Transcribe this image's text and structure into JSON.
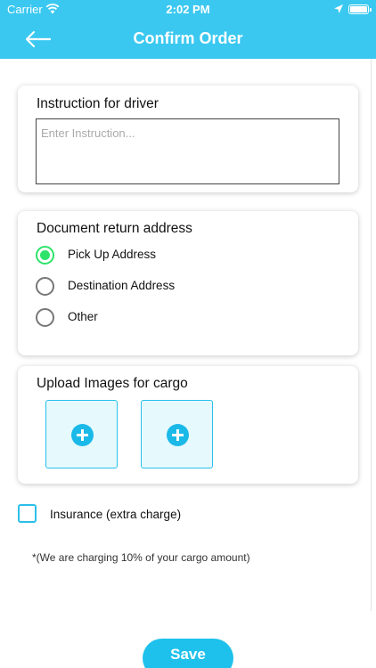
{
  "status_bar": {
    "carrier": "Carrier",
    "time": "2:02 PM",
    "battery_level": 1.0,
    "wifi_icon": "wifi-icon",
    "location_icon": "location-arrow-icon",
    "battery_icon": "battery-icon"
  },
  "nav": {
    "title": "Confirm Order",
    "back_icon": "arrow-left-icon"
  },
  "instruction": {
    "title": "Instruction for driver",
    "placeholder": "Enter Instruction...",
    "value": ""
  },
  "document_return": {
    "title": "Document return address",
    "options": [
      {
        "label": "Pick Up Address",
        "selected": true
      },
      {
        "label": "Destination Address",
        "selected": false
      },
      {
        "label": "Other",
        "selected": false
      }
    ]
  },
  "upload": {
    "title": "Upload Images for cargo",
    "slot_icon": "plus-circle-icon",
    "slots": 2
  },
  "insurance": {
    "label": "Insurance (extra charge)",
    "checked": false,
    "note": "*(We are charging 10% of your cargo amount)"
  },
  "save_label": "Save",
  "colors": {
    "header": "#3ac8f0",
    "accent": "#1ec1ec",
    "radio_selected": "#2ee36a",
    "upload_bg": "#e6f9fd"
  }
}
